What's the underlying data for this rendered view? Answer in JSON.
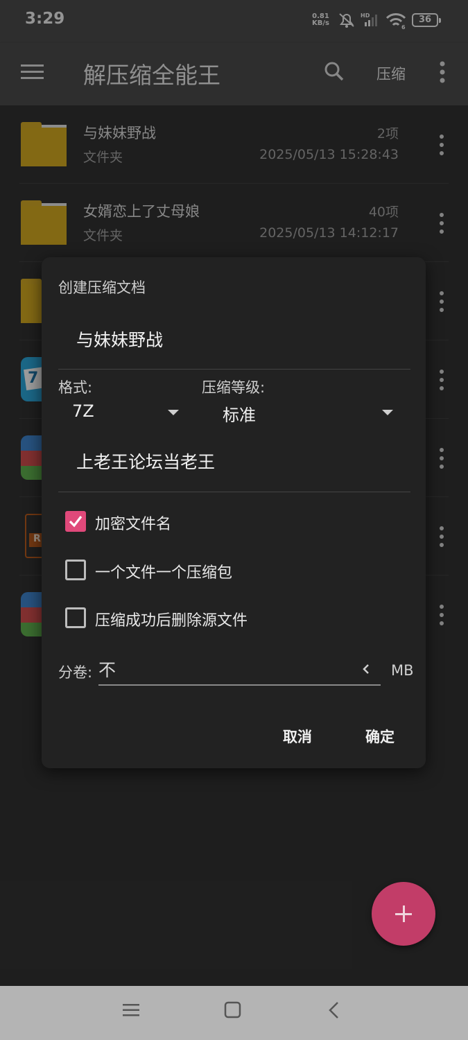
{
  "status_bar": {
    "time": "3:29",
    "net_speed_value": "0.81",
    "net_speed_unit": "KB/s",
    "signal_label": "HD",
    "wifi_label": "6",
    "battery": "36"
  },
  "toolbar": {
    "title": "解压缩全能王",
    "compress_label": "压缩"
  },
  "files": [
    {
      "name": "与妹妹野战",
      "type": "文件夹",
      "count": "2项",
      "date": "2025/05/13 15:28:43"
    },
    {
      "name": "女婿恋上了丈母娘",
      "type": "文件夹",
      "count": "40项",
      "date": "2025/05/13 14:12:17"
    }
  ],
  "dialog": {
    "title": "创建压缩文档",
    "archive_name": "与妹妹野战",
    "format_label": "格式:",
    "format_value": "7Z",
    "level_label": "压缩等级:",
    "level_value": "标准",
    "password": "上老王论坛当老王",
    "options": [
      {
        "label": "加密文件名",
        "checked": true
      },
      {
        "label": "一个文件一个压缩包",
        "checked": false
      },
      {
        "label": "压缩成功后删除源文件",
        "checked": false
      }
    ],
    "volume_label": "分卷:",
    "volume_value": "不",
    "volume_unit": "MB",
    "cancel_label": "取消",
    "ok_label": "确定"
  },
  "colors": {
    "accent": "#e0497a",
    "fab": "#c23d68",
    "folder": "#c9a11f"
  }
}
